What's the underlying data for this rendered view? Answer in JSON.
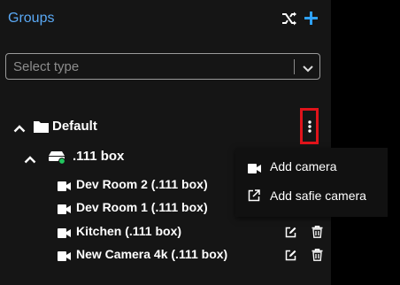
{
  "panel": {
    "title": "Groups",
    "select": {
      "placeholder": "Select type"
    }
  },
  "tree": {
    "group": {
      "label": "Default"
    },
    "box": {
      "label": ".111 box"
    },
    "cameras": [
      {
        "label": "Dev Room 2 (.111 box)"
      },
      {
        "label": "Dev Room 1 (.111 box)"
      },
      {
        "label": "Kitchen (.111 box)"
      },
      {
        "label": "New Camera 4k (.111 box)"
      }
    ]
  },
  "context_menu": {
    "items": [
      {
        "label": "Add camera",
        "icon": "video-camera-icon"
      },
      {
        "label": "Add safie camera",
        "icon": "external-link-icon"
      }
    ]
  },
  "colors": {
    "accent": "#5aa9f5",
    "add": "#2ea2ff",
    "panel_bg": "#151515",
    "highlight": "#e0141b",
    "status_online": "#22c55e"
  }
}
